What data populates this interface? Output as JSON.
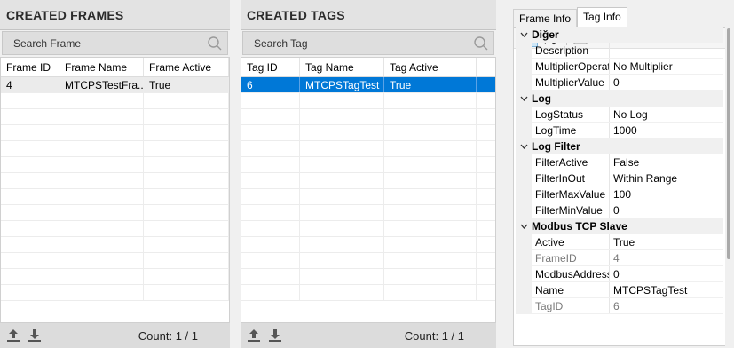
{
  "frames": {
    "title": "CREATED FRAMES",
    "search_placeholder": "Search Frame",
    "columns": [
      "Frame ID",
      "Frame Name",
      "Frame Active"
    ],
    "rows": [
      {
        "id": "4",
        "name": "MTCPSTestFra...",
        "active": "True"
      }
    ],
    "count": "Count: 1 / 1"
  },
  "tags": {
    "title": "CREATED TAGS",
    "search_placeholder": "Search Tag",
    "columns": [
      "Tag ID",
      "Tag Name",
      "Tag Active"
    ],
    "rows": [
      {
        "id": "6",
        "name": "MTCPSTagTest",
        "active": "True"
      }
    ],
    "count": "Count: 1 / 1"
  },
  "info": {
    "tabs": [
      "Frame Info",
      "Tag Info"
    ],
    "active_tab": "Tag Info",
    "categories": [
      {
        "name": "Diğer",
        "props": [
          {
            "name": "Description",
            "value": ""
          },
          {
            "name": "MultiplierOperat",
            "value": "No Multiplier"
          },
          {
            "name": "MultiplierValue",
            "value": "0"
          }
        ]
      },
      {
        "name": "Log",
        "props": [
          {
            "name": "LogStatus",
            "value": "No Log"
          },
          {
            "name": "LogTime",
            "value": "1000"
          }
        ]
      },
      {
        "name": "Log Filter",
        "props": [
          {
            "name": "FilterActive",
            "value": "False"
          },
          {
            "name": "FilterInOut",
            "value": "Within Range"
          },
          {
            "name": "FilterMaxValue",
            "value": "100"
          },
          {
            "name": "FilterMinValue",
            "value": "0"
          }
        ]
      },
      {
        "name": "Modbus TCP Slave",
        "props": [
          {
            "name": "Active",
            "value": "True"
          },
          {
            "name": "FrameID",
            "value": "4",
            "readonly": true
          },
          {
            "name": "ModbusAddress",
            "value": "0"
          },
          {
            "name": "Name",
            "value": "MTCPSTagTest"
          },
          {
            "name": "TagID",
            "value": "6",
            "readonly": true
          }
        ]
      }
    ]
  },
  "colors": {
    "selection": "#0078d7",
    "header_bg": "#e3e3e3"
  }
}
